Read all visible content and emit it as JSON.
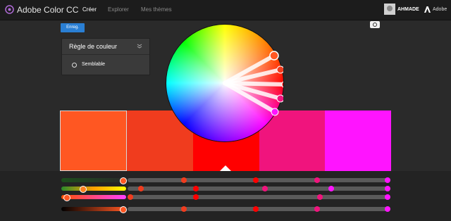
{
  "app": {
    "title": "Adobe Color CC"
  },
  "nav": {
    "create": "Créer",
    "explore": "Explorer",
    "themes": "Mes thèmes"
  },
  "user": {
    "name": "AHMADE",
    "adobe_label": "Adobe"
  },
  "toolbar": {
    "save_label": "Enreg."
  },
  "rule_panel": {
    "title": "Règle de couleur",
    "selected_option": "Semblable"
  },
  "theme": {
    "swatches": [
      "#ff5722",
      "#f03c1e",
      "#ff0000",
      "#f0147d",
      "#ff14ff"
    ],
    "selected_index": 0
  },
  "icons": {
    "logo": "adobe-color-logo-icon",
    "camera": "camera-icon",
    "chevron": "chevron-down-icon",
    "adobe": "adobe-logo-icon"
  }
}
